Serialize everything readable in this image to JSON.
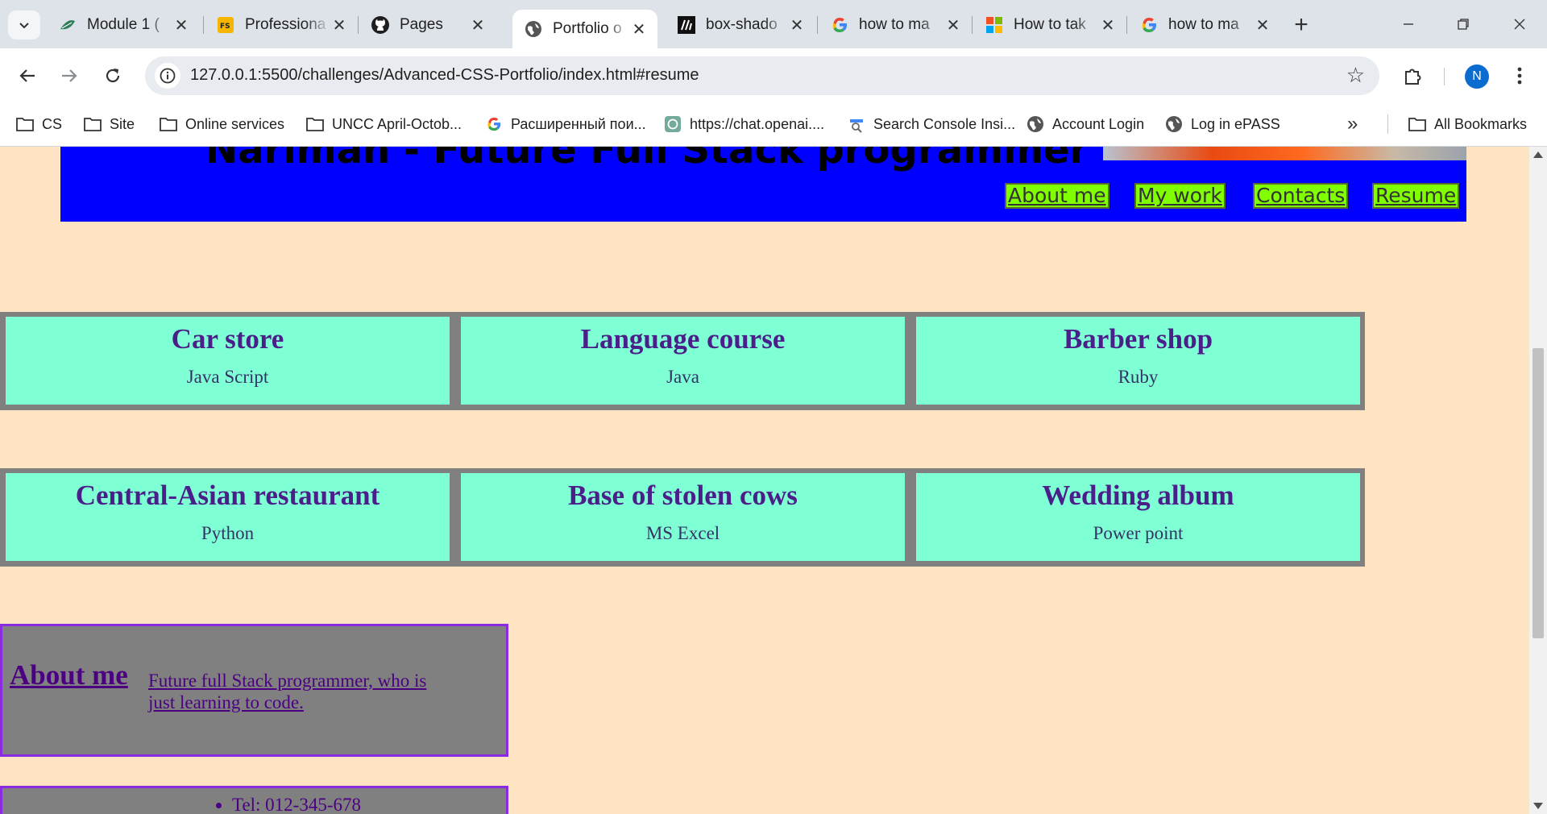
{
  "browser": {
    "tabs": [
      {
        "title": "Module 1 (",
        "icon": "leaf-icon"
      },
      {
        "title": "Professiona",
        "icon": "fs-icon"
      },
      {
        "title": "Pages",
        "icon": "github-icon"
      },
      {
        "title": "Portfolio o",
        "icon": "globe-icon",
        "active": true
      },
      {
        "title": "box-shado",
        "icon": "mdn-icon"
      },
      {
        "title": "how to ma",
        "icon": "google-icon"
      },
      {
        "title": "How to tak",
        "icon": "microsoft-icon"
      },
      {
        "title": "how to ma",
        "icon": "google-icon"
      }
    ],
    "new_tab_glyph": "+",
    "url": "127.0.0.1:5500/challenges/Advanced-CSS-Portfolio/index.html#resume",
    "profile_initial": "N",
    "bookmarks": [
      {
        "label": "CS",
        "icon": "folder-icon"
      },
      {
        "label": "Site",
        "icon": "folder-icon"
      },
      {
        "label": "Online services",
        "icon": "folder-icon"
      },
      {
        "label": "UNCC April-Octob...",
        "icon": "folder-icon"
      },
      {
        "label": "Расширенный пои...",
        "icon": "google-icon"
      },
      {
        "label": "https://chat.openai....",
        "icon": "openai-icon"
      },
      {
        "label": "Search Console Insi...",
        "icon": "search-console-icon"
      },
      {
        "label": "Account Login",
        "icon": "globe-icon"
      },
      {
        "label": "Log in ePASS",
        "icon": "globe-icon"
      }
    ],
    "more_bookmarks_glyph": "»",
    "all_bookmarks_label": "All Bookmarks"
  },
  "page": {
    "header_title": "Nariman - Future Full Stack programmer",
    "nav": [
      "About me",
      "My work",
      "Contacts",
      "Resume"
    ],
    "work_rows": [
      [
        {
          "title": "Car store",
          "tech": "Java Script"
        },
        {
          "title": "Language course",
          "tech": "Java"
        },
        {
          "title": "Barber shop",
          "tech": "Ruby"
        }
      ],
      [
        {
          "title": "Central-Asian restaurant",
          "tech": "Python"
        },
        {
          "title": "Base of stolen cows",
          "tech": "MS Excel"
        },
        {
          "title": "Wedding album",
          "tech": "Power point"
        }
      ]
    ],
    "about_title": "About me",
    "about_text": "Future full Stack programmer, who is just learning to code.",
    "contacts": [
      "Tel: 012-345-678"
    ]
  },
  "colors": {
    "page_bg": "#ffe4c4",
    "banner": "#0000ff",
    "nav_bg": "#7fff00",
    "card_bg": "#7fffd4",
    "row_bg": "#808080",
    "box_border": "#8a2be2"
  }
}
